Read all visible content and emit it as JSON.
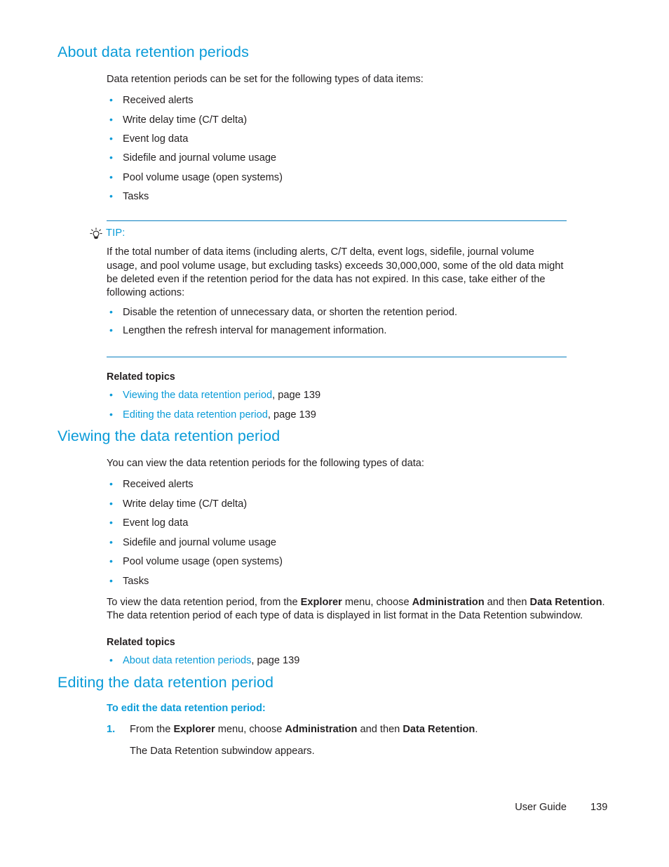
{
  "document": {
    "footer": {
      "guide_label": "User Guide",
      "page_number": "139"
    },
    "colors": {
      "heading": "#0a9bd8",
      "link": "#0a9bd8",
      "rule": "#0a7fc0",
      "body_text": "#231f20"
    }
  },
  "sections": [
    {
      "id": "about",
      "title": "About data retention periods",
      "intro": "Data retention periods can be set for the following types of data items:",
      "items": [
        "Received alerts",
        "Write delay time (C/T delta)",
        "Event log data",
        "Sidefile and journal volume usage",
        "Pool volume usage (open systems)",
        "Tasks"
      ],
      "tip": {
        "icon": "lightbulb-icon",
        "label": "TIP:",
        "body": "If the total number of data items (including alerts, C/T delta, event logs, sidefile, journal volume usage, and pool volume usage, but excluding tasks) exceeds 30,000,000, some of the old data might be deleted even if the retention period for the data has not expired. In this case, take either of the following actions:",
        "items": [
          "Disable the retention of unnecessary data, or shorten the retention period.",
          "Lengthen the refresh interval for management information."
        ]
      },
      "related": {
        "heading": "Related topics",
        "links": [
          {
            "text": "Viewing the data retention period",
            "suffix": ", page 139"
          },
          {
            "text": "Editing the data retention period",
            "suffix": ", page 139"
          }
        ]
      }
    },
    {
      "id": "viewing",
      "title": "Viewing the data retention period",
      "intro": "You can view the data retention periods for the following types of data:",
      "items": [
        "Received alerts",
        "Write delay time (C/T delta)",
        "Event log data",
        "Sidefile and journal volume usage",
        "Pool volume usage (open systems)",
        "Tasks"
      ],
      "paragraph": {
        "part1": "To view the data retention period, from the ",
        "bold1": "Explorer",
        "part2": " menu, choose ",
        "bold2": "Administration",
        "part3": " and then ",
        "bold3": "Data Retention",
        "part4": ". The data retention period of each type of data is displayed in list format in the Data Retention subwindow."
      },
      "related": {
        "heading": "Related topics",
        "links": [
          {
            "text": "About data retention periods",
            "suffix": ", page 139"
          }
        ]
      }
    },
    {
      "id": "editing",
      "title": "Editing the data retention period",
      "procedure_title": "To edit the data retention period:",
      "steps": [
        {
          "number": "1.",
          "part1": "From the ",
          "bold1": "Explorer",
          "part2": " menu, choose ",
          "bold2": "Administration",
          "part3": " and then ",
          "bold3": "Data Retention",
          "part4": ".",
          "result": "The Data Retention subwindow appears."
        }
      ]
    }
  ]
}
